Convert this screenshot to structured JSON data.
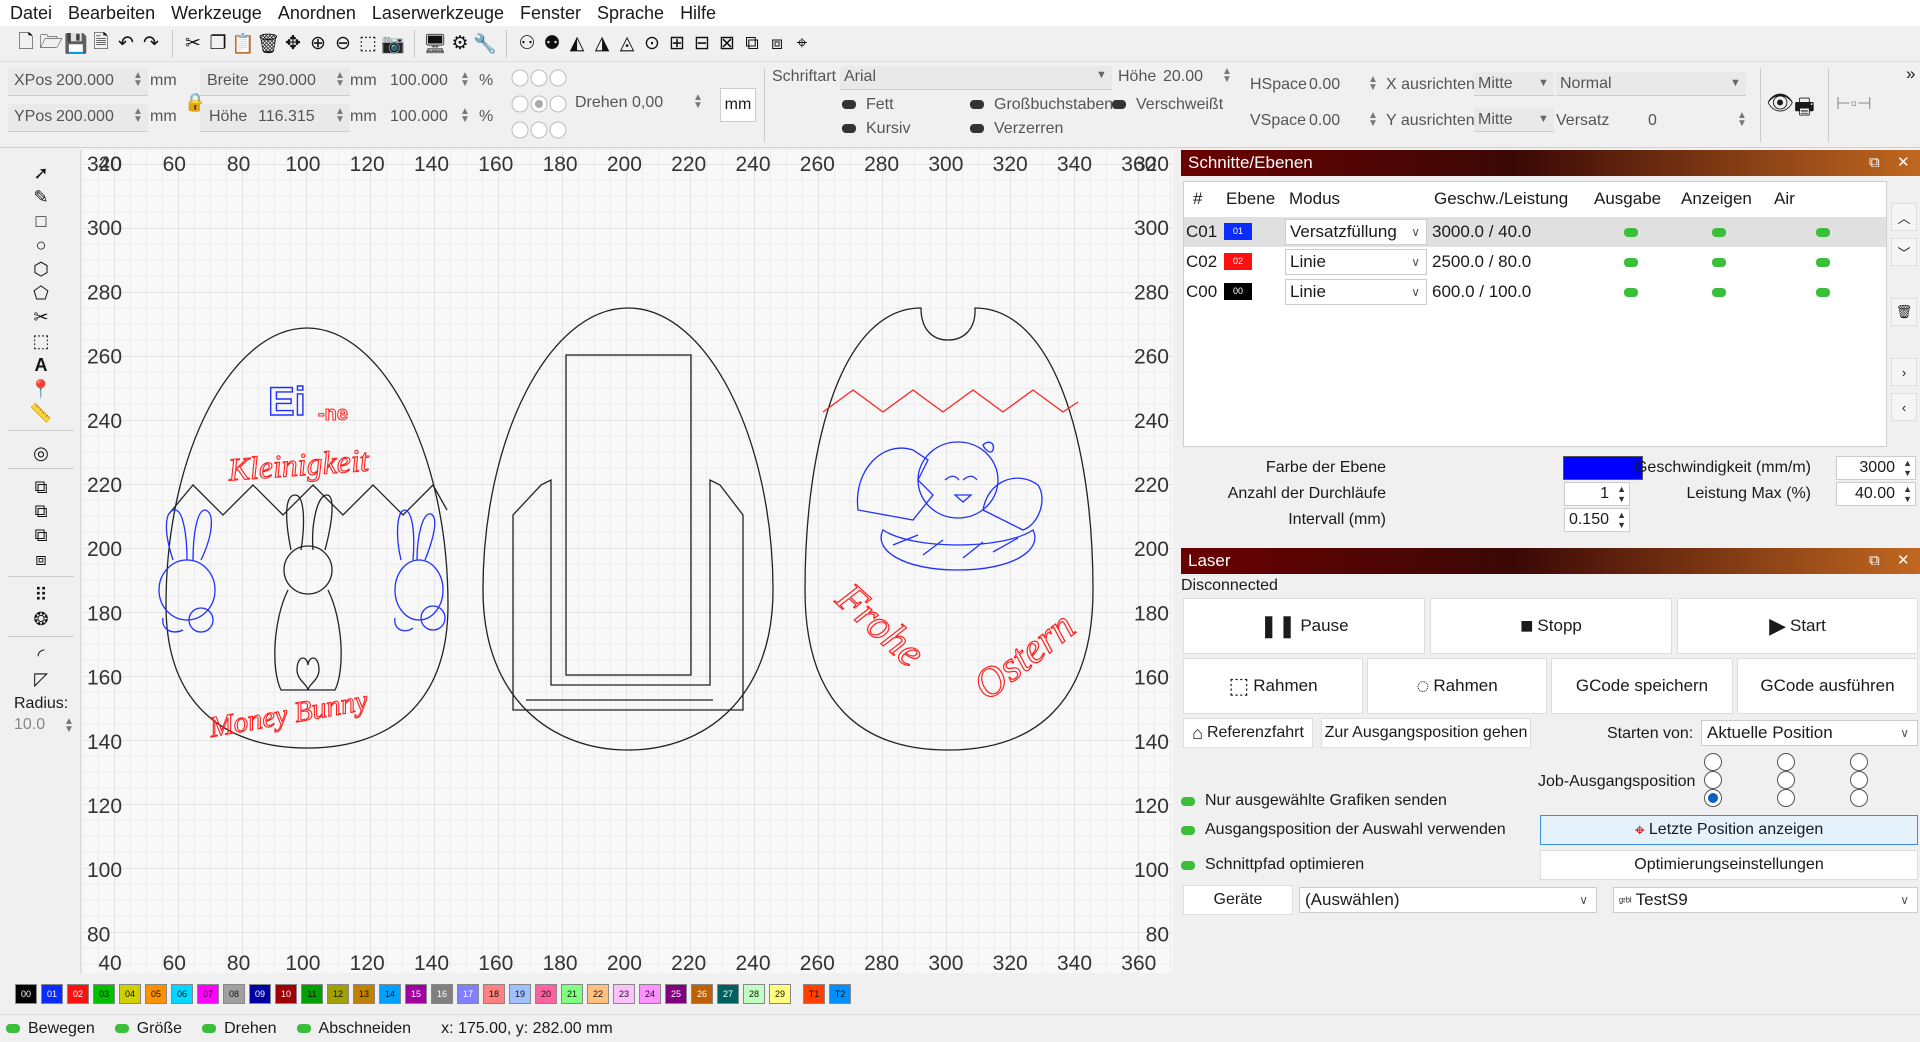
{
  "menu": [
    "Datei",
    "Bearbeiten",
    "Werkzeuge",
    "Anordnen",
    "Laserwerkzeuge",
    "Fenster",
    "Sprache",
    "Hilfe"
  ],
  "props": {
    "xpos_label": "XPos",
    "xpos": "200.000",
    "ypos_label": "YPos",
    "ypos": "200.000",
    "unit": "mm",
    "width_label": "Breite",
    "width": "290.000",
    "height_label": "Höhe",
    "height": "116.315",
    "scale_w": "100.000",
    "scale_h": "100.000",
    "pct": "%",
    "rotate_label": "Drehen",
    "rotate": "0,00",
    "unit_button": "mm",
    "font_label": "Schriftart",
    "font": "Arial",
    "font_height_label": "Höhe",
    "font_height": "20.00",
    "bold": "Fett",
    "italic": "Kursiv",
    "upper": "Großbuchstaben",
    "distort": "Verzerren",
    "welded": "Verschweißt",
    "hspace_label": "HSpace",
    "hspace": "0.00",
    "vspace_label": "VSpace",
    "vspace": "0.00",
    "xalign_label": "X ausrichten",
    "xalign": "Mitte",
    "yalign_label": "Y ausrichten",
    "yalign": "Mitte",
    "normal": "Normal",
    "offset_label": "Versatz",
    "offset": "0"
  },
  "left_tools": {
    "radius_label": "Radius:",
    "radius": "10.0"
  },
  "canvas": {
    "x_ticks": [
      "40",
      "60",
      "80",
      "100",
      "120",
      "140",
      "160",
      "180",
      "200",
      "220",
      "240",
      "260",
      "280",
      "300",
      "320",
      "340",
      "360"
    ],
    "y_ticks": [
      "320",
      "300",
      "280",
      "260",
      "240",
      "220",
      "200",
      "180",
      "160",
      "140",
      "120",
      "100",
      "80"
    ],
    "texts": {
      "eine_big": "Ei",
      "eine_small": "-ne",
      "kleinigkeit": "Kleinigkeit",
      "money_bunny": "Money Bunny",
      "frohe": "Frohe",
      "ostern": "Ostern"
    }
  },
  "layers": {
    "title": "Schnitte/Ebenen",
    "headers": [
      "#",
      "Ebene",
      "Modus",
      "Geschw./Leistung",
      "Ausgabe",
      "Anzeigen",
      "Air"
    ],
    "rows": [
      {
        "id": "C01",
        "badge": "01",
        "color": "#0a2cff",
        "mode": "Versatzfüllung",
        "speed": "3000.0 / 40.0"
      },
      {
        "id": "C02",
        "badge": "02",
        "color": "#ff1010",
        "mode": "Linie",
        "speed": "2500.0 / 80.0"
      },
      {
        "id": "C00",
        "badge": "00",
        "color": "#000000",
        "mode": "Linie",
        "speed": "600.0 / 100.0"
      }
    ],
    "color_label": "Farbe der Ebene",
    "layer_color": "#0000ff",
    "passes_label": "Anzahl der Durchläufe",
    "passes": "1",
    "interval_label": "Intervall (mm)",
    "interval": "0.150",
    "speed_label": "Geschwindigkeit (mm/m)",
    "speed": "3000",
    "power_label": "Leistung Max (%)",
    "power": "40.00"
  },
  "laser": {
    "title": "Laser",
    "status": "Disconnected",
    "pause": "Pause",
    "stop": "Stopp",
    "start": "Start",
    "frame1": "Rahmen",
    "frame2": "Rahmen",
    "save_gcode": "GCode speichern",
    "run_gcode": "GCode ausführen",
    "home": "Referenzfahrt",
    "goto_origin": "Zur Ausgangsposition gehen",
    "start_from_label": "Starten von:",
    "start_from": "Aktuelle Position",
    "job_origin_label": "Job-Ausgangsposition",
    "only_selected": "Nur ausgewählte Grafiken senden",
    "use_selection_origin": "Ausgangsposition der Auswahl verwenden",
    "optimize_path": "Schnittpfad optimieren",
    "show_last_pos": "Letzte Position anzeigen",
    "opt_settings": "Optimierungseinstellungen",
    "devices": "Geräte",
    "devices_select": "(Auswählen)",
    "device_name": "TestS9"
  },
  "palette": [
    {
      "label": "00",
      "color": "#000000"
    },
    {
      "label": "01",
      "color": "#0a2cff"
    },
    {
      "label": "02",
      "color": "#ff1010"
    },
    {
      "label": "03",
      "color": "#00c000"
    },
    {
      "label": "04",
      "color": "#d0d000"
    },
    {
      "label": "05",
      "color": "#ff9000"
    },
    {
      "label": "06",
      "color": "#00d8ff"
    },
    {
      "label": "07",
      "color": "#ff00ff"
    },
    {
      "label": "08",
      "color": "#a0a0a0"
    },
    {
      "label": "09",
      "color": "#0000a0"
    },
    {
      "label": "10",
      "color": "#a00000"
    },
    {
      "label": "11",
      "color": "#00a000"
    },
    {
      "label": "12",
      "color": "#a0a000"
    },
    {
      "label": "13",
      "color": "#c08000"
    },
    {
      "label": "14",
      "color": "#00a0ff"
    },
    {
      "label": "15",
      "color": "#a000a0"
    },
    {
      "label": "16",
      "color": "#808080"
    },
    {
      "label": "17",
      "color": "#8080ff"
    },
    {
      "label": "18",
      "color": "#ff8080"
    },
    {
      "label": "19",
      "color": "#a0c0ff"
    },
    {
      "label": "20",
      "color": "#ff60a0"
    },
    {
      "label": "21",
      "color": "#80ff80"
    },
    {
      "label": "22",
      "color": "#ffc080"
    },
    {
      "label": "23",
      "color": "#ffc0ff"
    },
    {
      "label": "24",
      "color": "#ff90ff"
    },
    {
      "label": "25",
      "color": "#800080"
    },
    {
      "label": "26",
      "color": "#c06000"
    },
    {
      "label": "27",
      "color": "#006060"
    },
    {
      "label": "28",
      "color": "#c0ffc0"
    },
    {
      "label": "29",
      "color": "#ffff80"
    },
    {
      "label": "T1",
      "color": "#ff4000"
    },
    {
      "label": "T2",
      "color": "#0090ff"
    }
  ],
  "status": {
    "move": "Bewegen",
    "size": "Größe",
    "rotate": "Drehen",
    "cut": "Abschneiden",
    "coords": "x: 175.00, y: 282.00 mm"
  }
}
